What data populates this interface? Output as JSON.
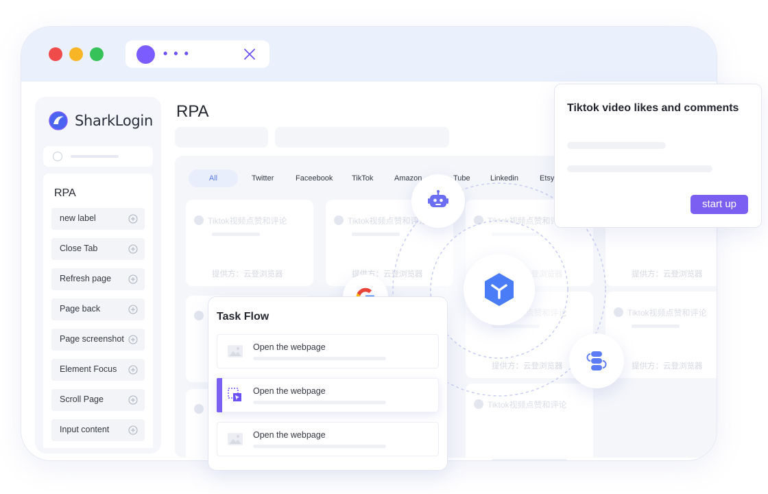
{
  "app": {
    "logo_text": "SharkLogin"
  },
  "sidebar": {
    "section_title": "RPA",
    "items": [
      {
        "label": "new label"
      },
      {
        "label": "Close Tab"
      },
      {
        "label": "Refresh page"
      },
      {
        "label": "Page back"
      },
      {
        "label": "Page screenshot"
      },
      {
        "label": "Element Focus"
      },
      {
        "label": "Scroll Page"
      },
      {
        "label": "Input content"
      }
    ]
  },
  "main": {
    "title": "RPA",
    "tabs": [
      {
        "label": "All"
      },
      {
        "label": "Twitter"
      },
      {
        "label": "Faceebook"
      },
      {
        "label": "TikTok"
      },
      {
        "label": "Amazon"
      },
      {
        "label": "Tube"
      },
      {
        "label": "Linkedin"
      },
      {
        "label": "Etsy"
      }
    ],
    "card_title": "Tiktok视频点赞和评论",
    "card_provider": "提供方：云登浏览器"
  },
  "popup": {
    "title": "Tiktok video likes and comments",
    "button": "start up"
  },
  "task_flow": {
    "title": "Task Flow",
    "steps": [
      {
        "label": "Open the webpage"
      },
      {
        "label": "Open the webpage"
      },
      {
        "label": "Open the webpage"
      }
    ]
  },
  "colors": {
    "accent": "#7b5ff3",
    "titlebar": "#ebf0fd",
    "center_icon": "#4a7cf7"
  },
  "icons": [
    "robot-icon",
    "google-icon",
    "cube-icon",
    "workflow-icon",
    "tiktok-icon",
    "plus-circle-icon",
    "image-icon",
    "select-icon"
  ]
}
